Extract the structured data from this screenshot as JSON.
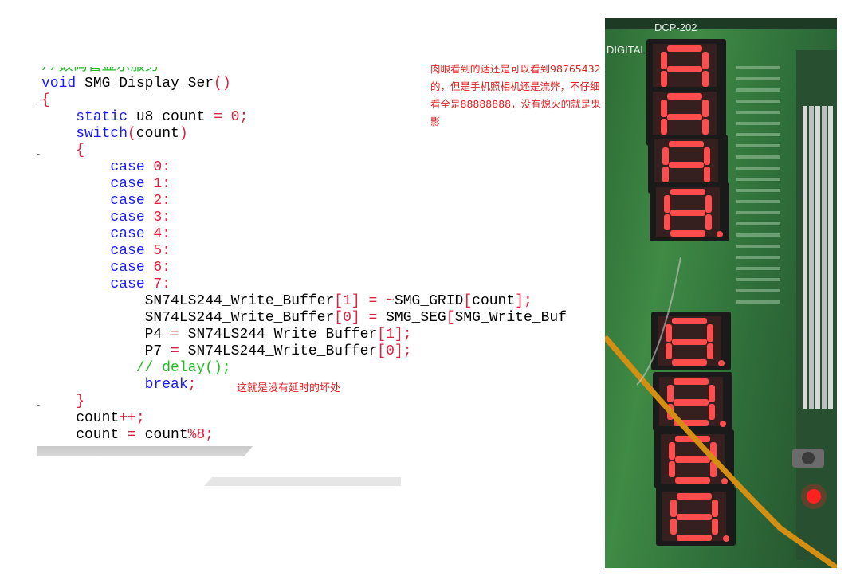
{
  "code": {
    "lines": [
      [
        {
          "c": "cm",
          "t": "//数码管显示服务"
        }
      ],
      [
        {
          "c": "kw",
          "t": "void"
        },
        {
          "c": "tx",
          "t": " SMG_Display_Ser"
        },
        {
          "c": "op",
          "t": "()"
        }
      ],
      [
        {
          "c": "op",
          "t": "{"
        }
      ],
      [
        {
          "c": "kw",
          "t": "    static"
        },
        {
          "c": "tx",
          "t": " u8 count "
        },
        {
          "c": "op",
          "t": "="
        },
        {
          "c": "num",
          "t": " 0"
        },
        {
          "c": "op",
          "t": ";"
        }
      ],
      [
        {
          "c": "kw",
          "t": "    switch"
        },
        {
          "c": "op",
          "t": "("
        },
        {
          "c": "tx",
          "t": "count"
        },
        {
          "c": "op",
          "t": ")"
        }
      ],
      [
        {
          "c": "op",
          "t": "    {"
        }
      ],
      [
        {
          "c": "kw",
          "t": "        case"
        },
        {
          "c": "num",
          "t": " 0"
        },
        {
          "c": "op",
          "t": ":"
        }
      ],
      [
        {
          "c": "kw",
          "t": "        case"
        },
        {
          "c": "num",
          "t": " 1"
        },
        {
          "c": "op",
          "t": ":"
        }
      ],
      [
        {
          "c": "kw",
          "t": "        case"
        },
        {
          "c": "num",
          "t": " 2"
        },
        {
          "c": "op",
          "t": ":"
        }
      ],
      [
        {
          "c": "kw",
          "t": "        case"
        },
        {
          "c": "num",
          "t": " 3"
        },
        {
          "c": "op",
          "t": ":"
        }
      ],
      [
        {
          "c": "kw",
          "t": "        case"
        },
        {
          "c": "num",
          "t": " 4"
        },
        {
          "c": "op",
          "t": ":"
        }
      ],
      [
        {
          "c": "kw",
          "t": "        case"
        },
        {
          "c": "num",
          "t": " 5"
        },
        {
          "c": "op",
          "t": ":"
        }
      ],
      [
        {
          "c": "kw",
          "t": "        case"
        },
        {
          "c": "num",
          "t": " 6"
        },
        {
          "c": "op",
          "t": ":"
        }
      ],
      [
        {
          "c": "kw",
          "t": "        case"
        },
        {
          "c": "num",
          "t": " 7"
        },
        {
          "c": "op",
          "t": ":"
        }
      ],
      [
        {
          "c": "tx",
          "t": "            SN74LS244_Write_Buffer"
        },
        {
          "c": "op",
          "t": "["
        },
        {
          "c": "num",
          "t": "1"
        },
        {
          "c": "op",
          "t": "]"
        },
        {
          "c": "op",
          "t": " = ~"
        },
        {
          "c": "tx",
          "t": "SMG_GRID"
        },
        {
          "c": "op",
          "t": "["
        },
        {
          "c": "tx",
          "t": "count"
        },
        {
          "c": "op",
          "t": "];"
        }
      ],
      [
        {
          "c": "tx",
          "t": "            SN74LS244_Write_Buffer"
        },
        {
          "c": "op",
          "t": "["
        },
        {
          "c": "num",
          "t": "0"
        },
        {
          "c": "op",
          "t": "]"
        },
        {
          "c": "op",
          "t": " = "
        },
        {
          "c": "tx",
          "t": "SMG_SEG"
        },
        {
          "c": "op",
          "t": "["
        },
        {
          "c": "tx",
          "t": "SMG_Write_Buf"
        }
      ],
      [
        {
          "c": "tx",
          "t": "            P4 "
        },
        {
          "c": "op",
          "t": "="
        },
        {
          "c": "tx",
          "t": " SN74LS244_Write_Buffer"
        },
        {
          "c": "op",
          "t": "["
        },
        {
          "c": "num",
          "t": "1"
        },
        {
          "c": "op",
          "t": "];"
        }
      ],
      [
        {
          "c": "tx",
          "t": "            P7 "
        },
        {
          "c": "op",
          "t": "="
        },
        {
          "c": "tx",
          "t": " SN74LS244_Write_Buffer"
        },
        {
          "c": "op",
          "t": "["
        },
        {
          "c": "num",
          "t": "0"
        },
        {
          "c": "op",
          "t": "];"
        }
      ],
      [
        {
          "c": "cm",
          "t": "           // delay();"
        }
      ],
      [
        {
          "c": "kw",
          "t": "            break"
        },
        {
          "c": "op",
          "t": ";"
        }
      ],
      [
        {
          "c": "op",
          "t": "    }"
        }
      ],
      [
        {
          "c": "tx",
          "t": "    count"
        },
        {
          "c": "op",
          "t": "++;"
        }
      ],
      [
        {
          "c": "tx",
          "t": "    count "
        },
        {
          "c": "op",
          "t": "="
        },
        {
          "c": "tx",
          "t": " count"
        },
        {
          "c": "op",
          "t": "%"
        },
        {
          "c": "num",
          "t": "8"
        },
        {
          "c": "op",
          "t": ";"
        }
      ]
    ]
  },
  "annotations": {
    "delay_note": "这就是没有延时的坏处",
    "observation_note": "肉眼看到的话还是可以看到98765432的，但是手机照相机还是流弊，不仔细看全是88888888，没有熄灭的就是鬼影"
  },
  "photo": {
    "board_label": "DCP-202",
    "board_label_2": "DIGITAL",
    "displayed_digits": "88888888",
    "colors": {
      "pcb": "#2f7a3b",
      "segment_on": "#ff4d4d",
      "wire": "#e8a21a"
    }
  }
}
